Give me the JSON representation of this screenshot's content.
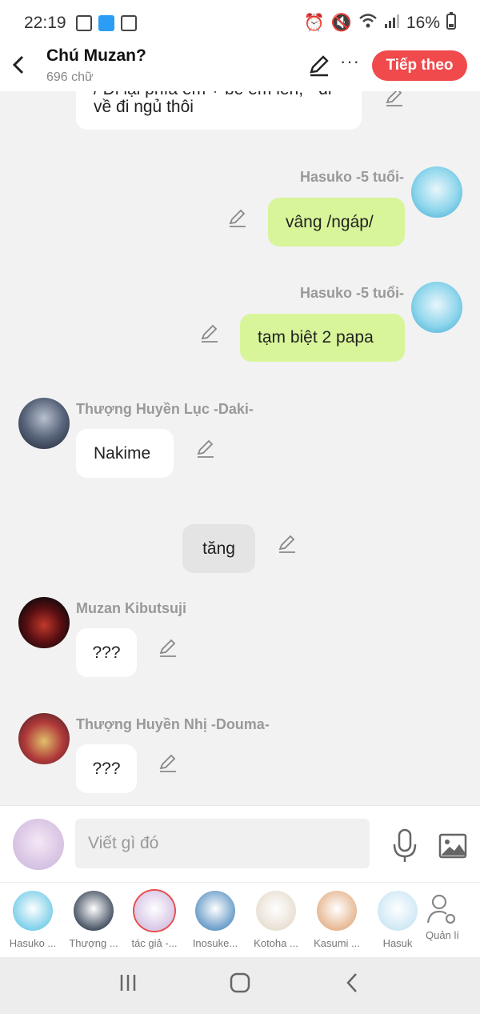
{
  "status": {
    "time": "22:19",
    "battery": "16%"
  },
  "header": {
    "title": "Chú Muzan?",
    "subtitle": "696 chữ",
    "next_label": "Tiếp theo",
    "more_label": "···"
  },
  "messages": [
    {
      "side": "left",
      "text": "về đi ngủ thôi",
      "partial_text": "/ Đi lại phía em + bế em lên, \" đi"
    },
    {
      "side": "right",
      "name": "Hasuko -5 tuổi-",
      "text": "vâng /ngáp/"
    },
    {
      "side": "right",
      "name": "Hasuko -5 tuổi-",
      "text": "tạm biệt 2 papa"
    },
    {
      "side": "left",
      "name": "Thượng Huyền Lục -Daki-",
      "text": "Nakime"
    },
    {
      "side": "center",
      "text": "tăng"
    },
    {
      "side": "left",
      "name": "Muzan Kibutsuji",
      "text": "???"
    },
    {
      "side": "left",
      "name": "Thượng Huyền Nhị -Douma-",
      "text": "???"
    }
  ],
  "composer": {
    "placeholder": "Viết gì đó"
  },
  "characters": [
    {
      "label": "Hasuko ...",
      "color": "#7fd0ea"
    },
    {
      "label": "Thượng ...",
      "color": "#4a5566"
    },
    {
      "label": "tác giả -...",
      "color": "#d8c7e6"
    },
    {
      "label": "Inosuke...",
      "color": "#6c9ec9"
    },
    {
      "label": "Kotoha ...",
      "color": "#e9e0d4"
    },
    {
      "label": "Kasumi ...",
      "color": "#e7b893"
    },
    {
      "label": "Hasuk",
      "color": "#cfe8f5"
    }
  ],
  "manage_label": "Quản lí",
  "colors": {
    "accent": "#f04a4c",
    "own_bubble": "#d8f59a",
    "other_bubble": "#ffffff"
  }
}
